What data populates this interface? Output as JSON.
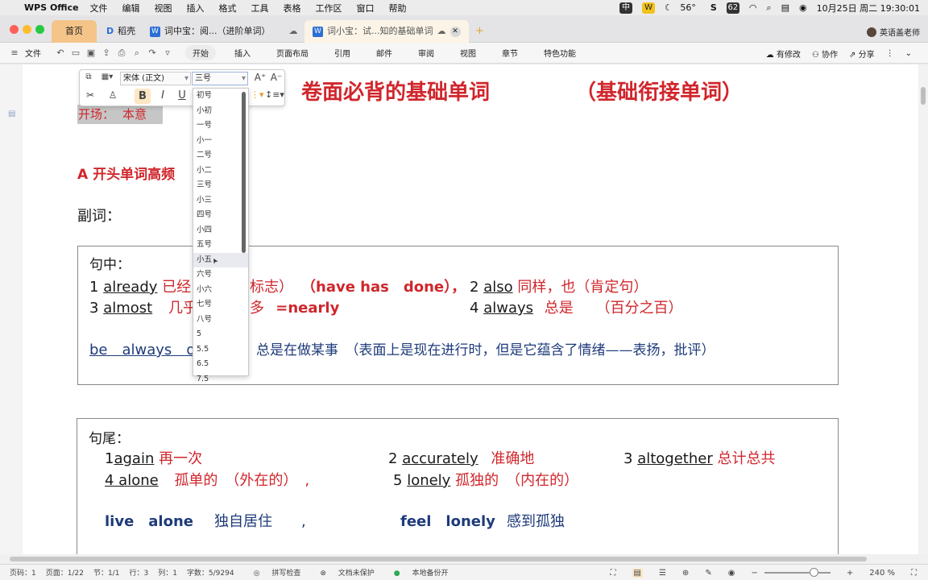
{
  "menubar": {
    "app": "WPS Office",
    "items": [
      "文件",
      "编辑",
      "视图",
      "插入",
      "格式",
      "工具",
      "表格",
      "工作区",
      "窗口",
      "帮助"
    ],
    "input_method": "中",
    "wps_icon": "W",
    "weather": "56°",
    "battery_label": "62",
    "datetime": "10月25日 周二  19:30:01"
  },
  "tabs": {
    "home": "首页",
    "daoke": "稻壳",
    "doc1": "词中宝：阅...（进阶单词）",
    "doc2": "词小宝：试...知的基础单词",
    "user": "英语盖老师"
  },
  "ribbon": {
    "file": "文件",
    "tabs": [
      "开始",
      "插入",
      "页面布局",
      "引用",
      "邮件",
      "审阅",
      "视图",
      "章节",
      "特色功能"
    ],
    "right": [
      "有修改",
      "协作",
      "分享"
    ]
  },
  "doc": {
    "title_left": "卷面必背的基础单词",
    "title_right": "（基础衔接单词）",
    "opening_label": "开场：",
    "opening_value": "本意",
    "section_a": "A 开头单词高频",
    "adverb_label": "副词：",
    "box1": {
      "heading": "句中：",
      "l1_num": "1",
      "l1_word": "already",
      "l1_cn": "已经",
      "l1_note": "标志）",
      "l1_paren": "（have has　done），",
      "l1_num2": "2",
      "l1_word2": "also",
      "l1_cn2": "同样，也（肯定句）",
      "l2_num": "3",
      "l2_word": "almost",
      "l2_cn": "几乎",
      "l2_cn_b": "多",
      "l2_eq": "=nearly",
      "l2_num2": "4",
      "l2_word2": "always",
      "l2_cn2": "总是",
      "l2_paren": "（百分之百）",
      "l3_phrase": "be　always　d",
      "l3_cn": "总是在做某事　（表面上是现在进行时，但是它蕴含了情绪——表扬，批评）"
    },
    "box2": {
      "heading": "句尾：",
      "a1_num": "1",
      "a1_word": "again",
      "a1_cn": "再一次",
      "a2_num": "2",
      "a2_word": "accurately",
      "a2_cn": "准确地",
      "a3_num": "3",
      "a3_word": "altogether",
      "a3_cn": "总计总共",
      "b1_word": "4 alone",
      "b1_cn": "孤单的　（外在的）　,",
      "b2_num": "5",
      "b2_word": "lonely",
      "b2_cn": "孤独的　（内在的）",
      "c1_phrase": "live　alone",
      "c1_cn": "独自居住　　,",
      "c2_phrase": "feel　lonely",
      "c2_cn": "感到孤独"
    }
  },
  "minitoolbar": {
    "font_name": "宋体 (正文)",
    "font_size": "三号",
    "grow": "A⁺",
    "shrink": "A⁻",
    "bold": "B",
    "italic": "I",
    "underline": "U"
  },
  "font_sizes": [
    "初号",
    "小初",
    "一号",
    "小一",
    "二号",
    "小二",
    "三号",
    "小三",
    "四号",
    "小四",
    "五号",
    "小五",
    "六号",
    "小六",
    "七号",
    "八号",
    "5",
    "5.5",
    "6.5",
    "7.5"
  ],
  "font_size_hover": "小五",
  "status": {
    "page_no": "页码：1",
    "pages": "页面：1/22",
    "section": "节：1/1",
    "row": "行：3",
    "col": "列：1",
    "words": "字数：5/9294",
    "spell": "拼写检查",
    "protect": "文档未保护",
    "backup": "本地备份开",
    "zoom": "240 %",
    "zoom_level": 0.75
  }
}
